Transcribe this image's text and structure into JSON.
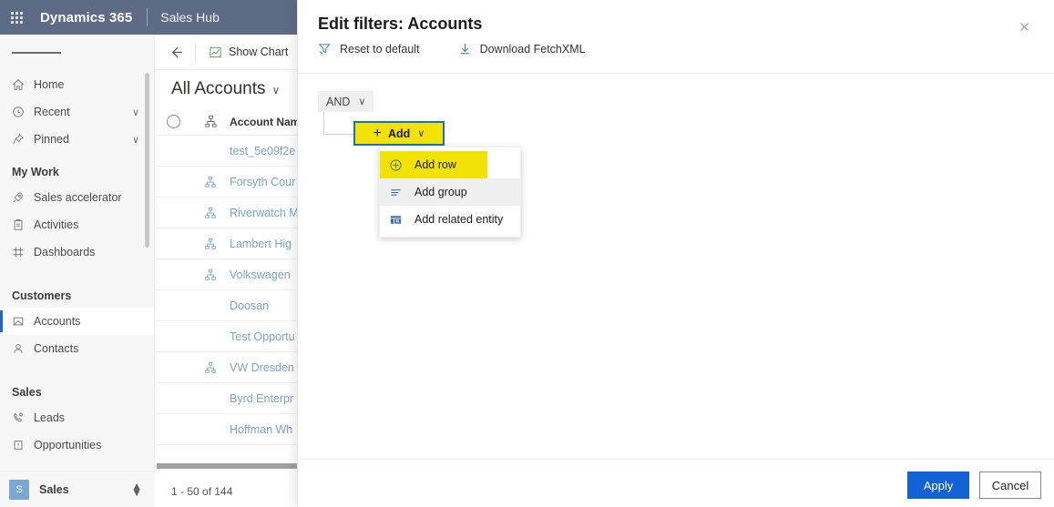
{
  "appbar": {
    "waffle_label": "app-launcher",
    "brand": "Dynamics 365",
    "app_name": "Sales Hub"
  },
  "sidebar": {
    "hamburger_label": "Site map",
    "items": [
      {
        "label": "Home",
        "icon": "home-icon",
        "chevron": "",
        "selected": false
      },
      {
        "label": "Recent",
        "icon": "clock-icon",
        "chevron": "∨",
        "selected": false
      },
      {
        "label": "Pinned",
        "icon": "pin-icon",
        "chevron": "∨",
        "selected": false
      }
    ],
    "groups": [
      {
        "title": "My Work",
        "items": [
          {
            "label": "Sales accelerator",
            "icon": "rocket-icon",
            "selected": false
          },
          {
            "label": "Activities",
            "icon": "clipboard-icon",
            "selected": false
          },
          {
            "label": "Dashboards",
            "icon": "dashboard-icon",
            "selected": false
          }
        ]
      },
      {
        "title": "Customers",
        "items": [
          {
            "label": "Accounts",
            "icon": "account-icon",
            "selected": true
          },
          {
            "label": "Contacts",
            "icon": "contact-icon",
            "selected": false
          }
        ]
      },
      {
        "title": "Sales",
        "items": [
          {
            "label": "Leads",
            "icon": "lead-icon",
            "selected": false
          },
          {
            "label": "Opportunities",
            "icon": "opportunity-icon",
            "selected": false
          }
        ]
      }
    ],
    "footer": {
      "avatar_initial": "S",
      "label": "Sales"
    }
  },
  "commandbar": {
    "back_label": "Back",
    "show_chart": "Show Chart",
    "new_label": "+"
  },
  "view": {
    "title": "All Accounts",
    "chevron": "∨"
  },
  "grid": {
    "columns": [
      "",
      "",
      "Account Name"
    ],
    "rows": [
      {
        "hierarchy": false,
        "name": "test_5e09f2e"
      },
      {
        "hierarchy": true,
        "name": "Forsyth Cour"
      },
      {
        "hierarchy": true,
        "name": "Riverwatch M"
      },
      {
        "hierarchy": true,
        "name": "Lambert Hig"
      },
      {
        "hierarchy": true,
        "name": "Volkswagen"
      },
      {
        "hierarchy": false,
        "name": "Doosan"
      },
      {
        "hierarchy": false,
        "name": "Test Opportu"
      },
      {
        "hierarchy": true,
        "name": "VW Dresden"
      },
      {
        "hierarchy": false,
        "name": "Byrd Enterpr"
      },
      {
        "hierarchy": false,
        "name": "Hoffman Wh"
      }
    ],
    "pager": "1 - 50 of 144"
  },
  "panel": {
    "title": "Edit filters: Accounts",
    "close_label": "✕",
    "actions": [
      {
        "label": "Reset to default",
        "icon": "reset-filter-icon"
      },
      {
        "label": "Download FetchXML",
        "icon": "download-icon"
      }
    ],
    "and_pill": {
      "label": "AND",
      "chevron": "∨"
    },
    "add_button": {
      "plus": "+",
      "label": "Add",
      "chevron": "∨"
    },
    "menu": [
      {
        "label": "Add row",
        "icon": "circle-plus-icon",
        "state": "highlighted"
      },
      {
        "label": "Add group",
        "icon": "group-lines-icon",
        "state": "hover"
      },
      {
        "label": "Add related entity",
        "icon": "related-entity-icon",
        "state": "normal"
      }
    ],
    "footer": {
      "apply": "Apply",
      "cancel": "Cancel"
    }
  },
  "colors": {
    "appbar": "#5d6b84",
    "accent_blue": "#1262d4",
    "highlight_yellow": "#f2e205",
    "focus_border": "#1b6ec2",
    "link_blue": "#7ba3c9"
  }
}
